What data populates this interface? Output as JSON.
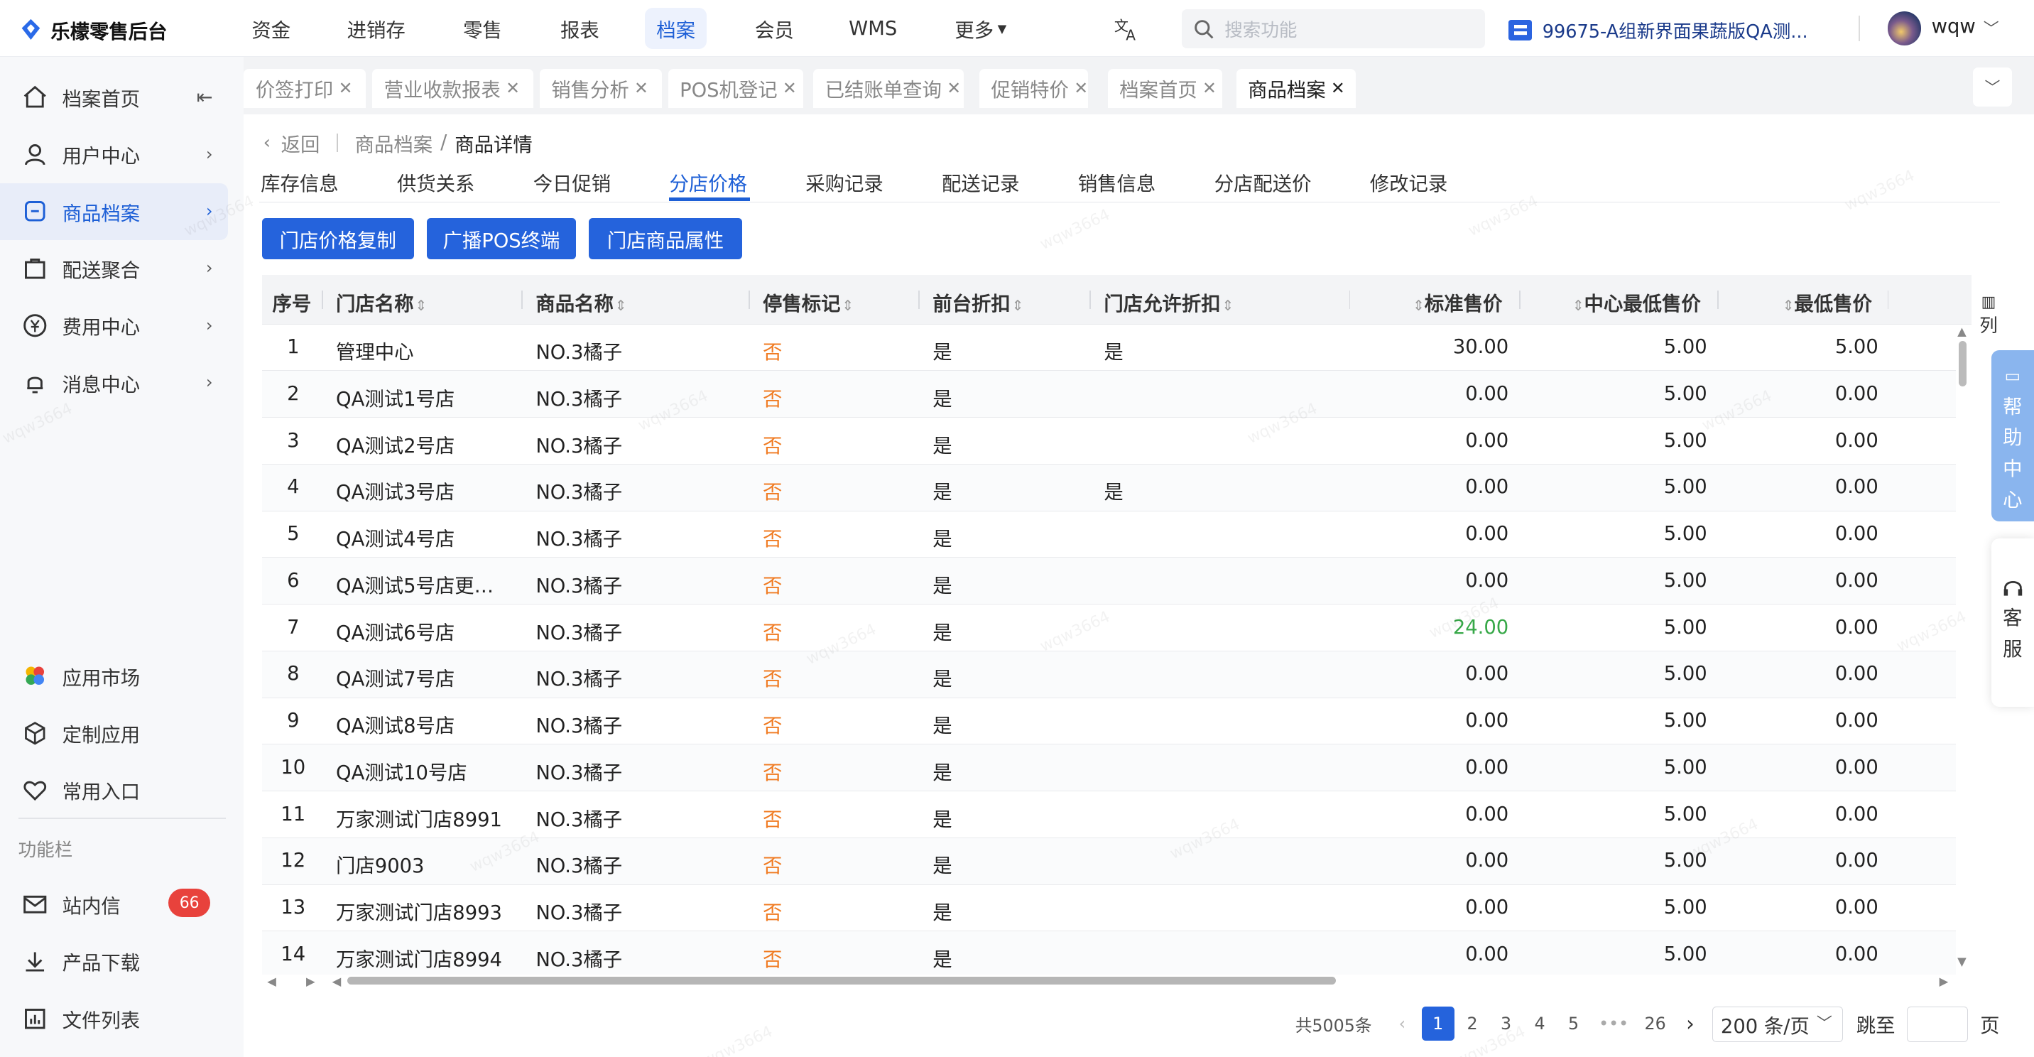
{
  "app": {
    "title": "乐檬零售后台"
  },
  "topnav": [
    {
      "label": "资金"
    },
    {
      "label": "进销存"
    },
    {
      "label": "零售"
    },
    {
      "label": "报表"
    },
    {
      "label": "档案"
    },
    {
      "label": "会员"
    },
    {
      "label": "WMS"
    },
    {
      "label": "更多"
    }
  ],
  "search": {
    "placeholder": "搜索功能"
  },
  "org": {
    "label": "99675-A组新界面果蔬版QA测..."
  },
  "user": {
    "name": "wqw"
  },
  "sidebar": {
    "items": [
      {
        "label": "档案首页"
      },
      {
        "label": "用户中心"
      },
      {
        "label": "商品档案"
      },
      {
        "label": "配送聚合"
      },
      {
        "label": "费用中心"
      },
      {
        "label": "消息中心"
      }
    ],
    "bottom": [
      {
        "label": "应用市场"
      },
      {
        "label": "定制应用"
      },
      {
        "label": "常用入口"
      }
    ],
    "func_title": "功能栏",
    "func": [
      {
        "label": "站内信",
        "badge": "66"
      },
      {
        "label": "产品下载"
      },
      {
        "label": "文件列表"
      }
    ]
  },
  "tabs": [
    {
      "label": "价签打印"
    },
    {
      "label": "营业收款报表"
    },
    {
      "label": "销售分析"
    },
    {
      "label": "POS机登记"
    },
    {
      "label": "已结账单查询"
    },
    {
      "label": "促销特价"
    },
    {
      "label": "档案首页"
    },
    {
      "label": "商品档案"
    }
  ],
  "breadcrumb": {
    "back": "返回",
    "parent": "商品档案",
    "sep": "/",
    "current": "商品详情"
  },
  "subtabs": [
    {
      "label": "库存信息"
    },
    {
      "label": "供货关系"
    },
    {
      "label": "今日促销"
    },
    {
      "label": "分店价格"
    },
    {
      "label": "采购记录"
    },
    {
      "label": "配送记录"
    },
    {
      "label": "销售信息"
    },
    {
      "label": "分店配送价"
    },
    {
      "label": "修改记录"
    }
  ],
  "actions": [
    {
      "label": "门店价格复制"
    },
    {
      "label": "广播POS终端"
    },
    {
      "label": "门店商品属性"
    }
  ],
  "table": {
    "columns": [
      {
        "label": "序号"
      },
      {
        "label": "门店名称"
      },
      {
        "label": "商品名称"
      },
      {
        "label": "停售标记"
      },
      {
        "label": "前台折扣"
      },
      {
        "label": "门店允许折扣"
      },
      {
        "label": "标准售价"
      },
      {
        "label": "中心最低售价"
      },
      {
        "label": "最低售价"
      }
    ],
    "column_panel": "列",
    "rows": [
      {
        "no": "1",
        "store": "管理中心",
        "product": "NO.3橘子",
        "stop": "否",
        "front": "是",
        "allow": "是",
        "std": "30.00",
        "center_min": "5.00",
        "min": "5.00"
      },
      {
        "no": "2",
        "store": "QA测试1号店",
        "product": "NO.3橘子",
        "stop": "否",
        "front": "是",
        "allow": "",
        "std": "0.00",
        "center_min": "5.00",
        "min": "0.00"
      },
      {
        "no": "3",
        "store": "QA测试2号店",
        "product": "NO.3橘子",
        "stop": "否",
        "front": "是",
        "allow": "",
        "std": "0.00",
        "center_min": "5.00",
        "min": "0.00"
      },
      {
        "no": "4",
        "store": "QA测试3号店",
        "product": "NO.3橘子",
        "stop": "否",
        "front": "是",
        "allow": "是",
        "std": "0.00",
        "center_min": "5.00",
        "min": "0.00"
      },
      {
        "no": "5",
        "store": "QA测试4号店",
        "product": "NO.3橘子",
        "stop": "否",
        "front": "是",
        "allow": "",
        "std": "0.00",
        "center_min": "5.00",
        "min": "0.00"
      },
      {
        "no": "6",
        "store": "QA测试5号店更…",
        "product": "NO.3橘子",
        "stop": "否",
        "front": "是",
        "allow": "",
        "std": "0.00",
        "center_min": "5.00",
        "min": "0.00"
      },
      {
        "no": "7",
        "store": "QA测试6号店",
        "product": "NO.3橘子",
        "stop": "否",
        "front": "是",
        "allow": "",
        "std": "24.00",
        "center_min": "5.00",
        "min": "0.00"
      },
      {
        "no": "8",
        "store": "QA测试7号店",
        "product": "NO.3橘子",
        "stop": "否",
        "front": "是",
        "allow": "",
        "std": "0.00",
        "center_min": "5.00",
        "min": "0.00"
      },
      {
        "no": "9",
        "store": "QA测试8号店",
        "product": "NO.3橘子",
        "stop": "否",
        "front": "是",
        "allow": "",
        "std": "0.00",
        "center_min": "5.00",
        "min": "0.00"
      },
      {
        "no": "10",
        "store": "QA测试10号店",
        "product": "NO.3橘子",
        "stop": "否",
        "front": "是",
        "allow": "",
        "std": "0.00",
        "center_min": "5.00",
        "min": "0.00"
      },
      {
        "no": "11",
        "store": "万家测试门店8991",
        "product": "NO.3橘子",
        "stop": "否",
        "front": "是",
        "allow": "",
        "std": "0.00",
        "center_min": "5.00",
        "min": "0.00"
      },
      {
        "no": "12",
        "store": "门店9003",
        "product": "NO.3橘子",
        "stop": "否",
        "front": "是",
        "allow": "",
        "std": "0.00",
        "center_min": "5.00",
        "min": "0.00"
      },
      {
        "no": "13",
        "store": "万家测试门店8993",
        "product": "NO.3橘子",
        "stop": "否",
        "front": "是",
        "allow": "",
        "std": "0.00",
        "center_min": "5.00",
        "min": "0.00"
      },
      {
        "no": "14",
        "store": "万家测试门店8994",
        "product": "NO.3橘子",
        "stop": "否",
        "front": "是",
        "allow": "",
        "std": "0.00",
        "center_min": "5.00",
        "min": "0.00"
      }
    ]
  },
  "help": {
    "label": "帮助中心"
  },
  "service": {
    "label": "客服"
  },
  "pagination": {
    "total": "共5005条",
    "pages": [
      "1",
      "2",
      "3",
      "4",
      "5",
      "•••",
      "26"
    ],
    "current": "1",
    "page_size": "200 条/页",
    "jump_label": "跳至",
    "jump_suffix": "页"
  },
  "watermark": "wqw3664",
  "colors": {
    "primary": "#2563dc",
    "active_bg": "#edf2fd",
    "warning": "#f07b22",
    "success": "#37a848",
    "danger": "#e8423c"
  }
}
